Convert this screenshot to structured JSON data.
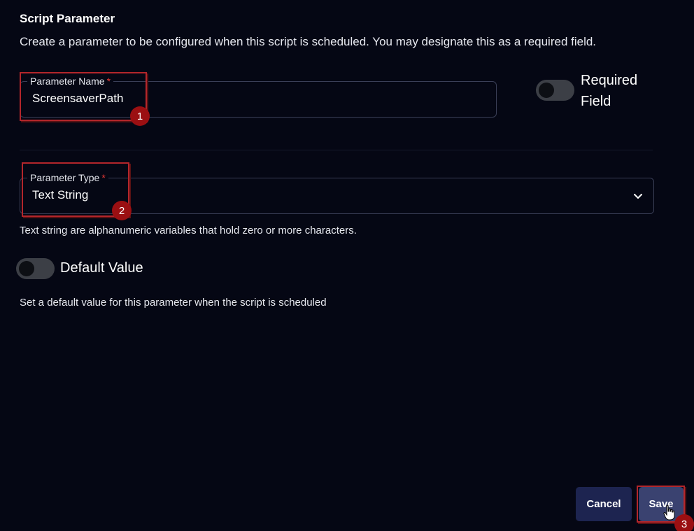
{
  "dialog": {
    "title": "Script Parameter",
    "subtitle": "Create a parameter to be configured when this script is scheduled. You may designate this as a required field."
  },
  "parameter_name": {
    "label": "Parameter Name",
    "required_marker": "*",
    "value": "ScreensaverPath"
  },
  "required_field": {
    "label": "Required Field",
    "enabled": false
  },
  "parameter_type": {
    "label": "Parameter Type",
    "required_marker": "*",
    "value": "Text String",
    "icon": "chevron-down-icon",
    "helper": "Text string are alphanumeric variables that hold zero or more characters."
  },
  "default_value": {
    "label": "Default Value",
    "enabled": false,
    "helper": "Set a default value for this parameter when the script is scheduled"
  },
  "buttons": {
    "cancel": "Cancel",
    "save": "Save"
  },
  "annotations": {
    "step1": "1",
    "step2": "2",
    "step3": "3"
  },
  "colors": {
    "background": "#050714",
    "cancel_button": "#1d2450",
    "save_button": "#3a4270",
    "required_asterisk": "#e53935",
    "highlight": "#b3262b"
  }
}
